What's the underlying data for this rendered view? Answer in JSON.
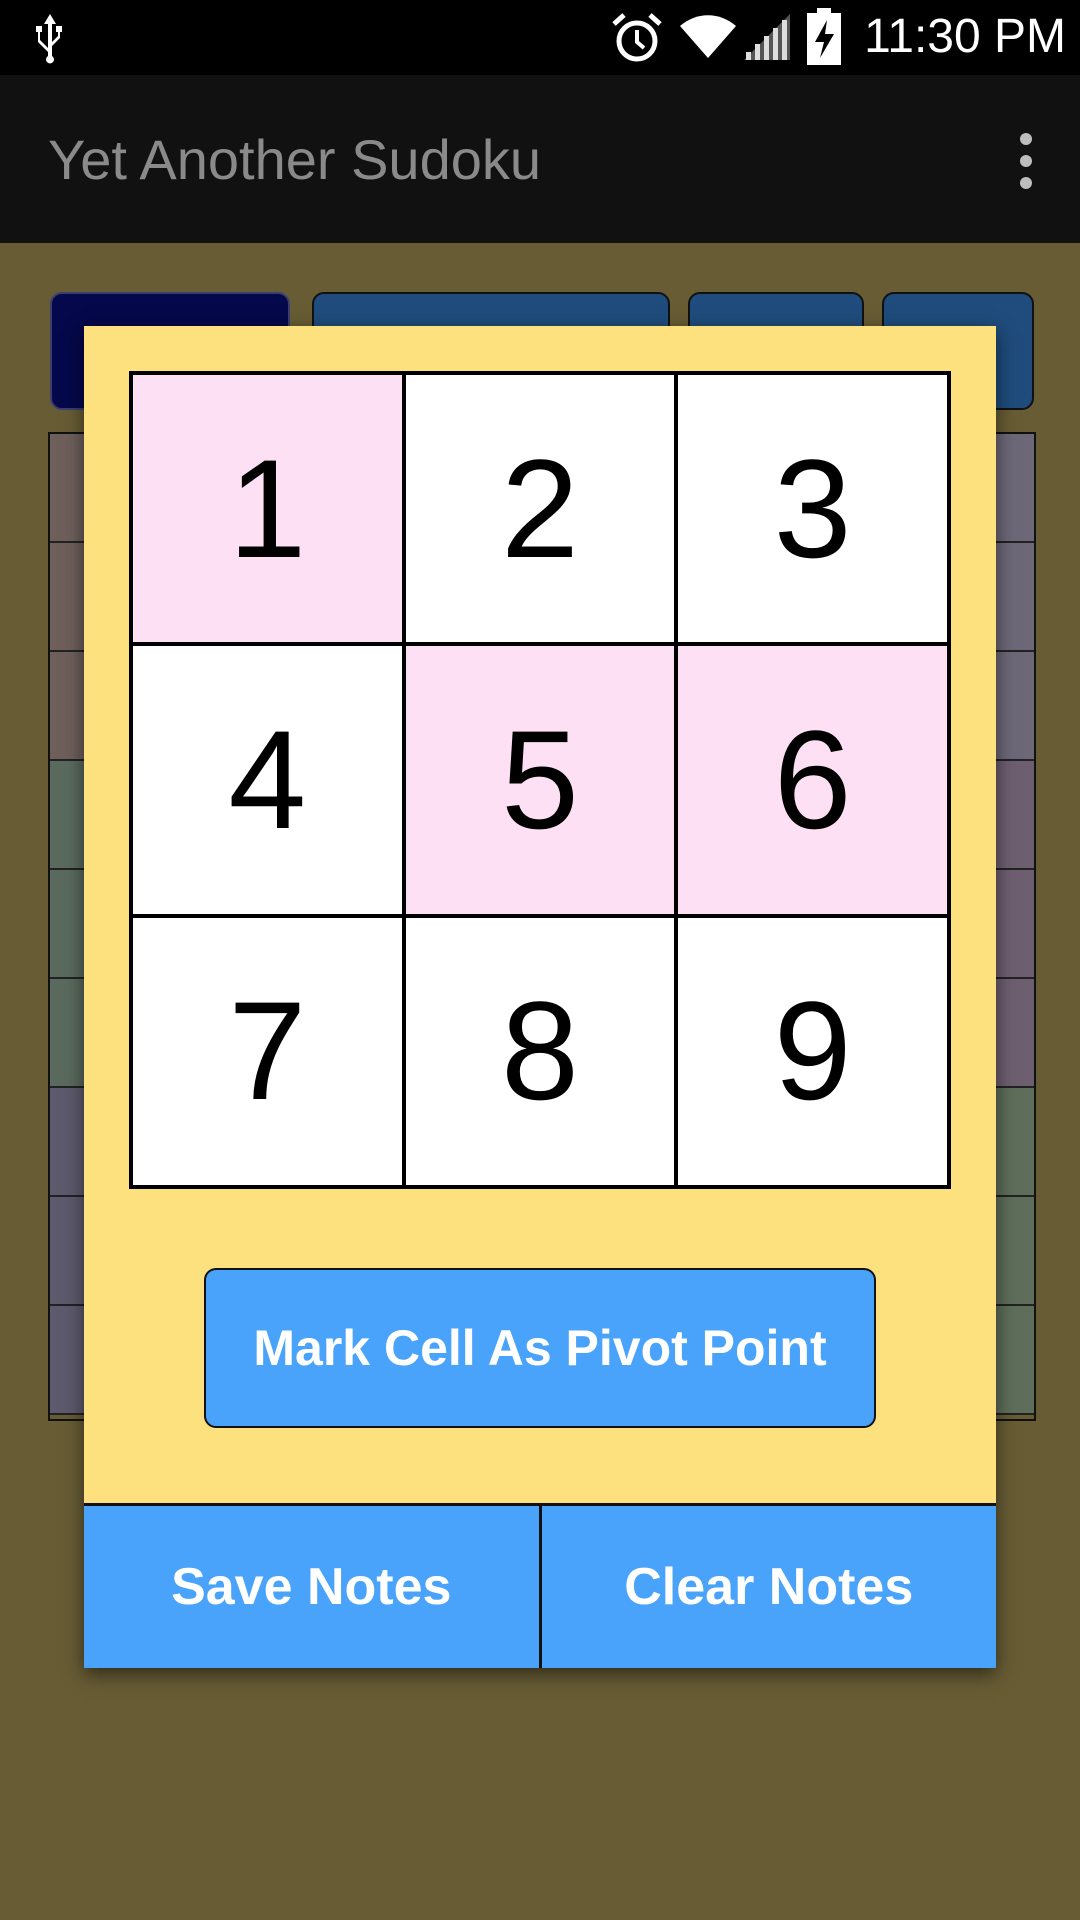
{
  "status_bar": {
    "time": "11:30 PM",
    "icons": [
      "usb-icon",
      "alarm-icon",
      "wifi-icon",
      "signal-icon",
      "battery-charging-icon"
    ]
  },
  "action_bar": {
    "title": "Yet Another Sudoku",
    "overflow_icon": "overflow-menu-icon"
  },
  "dialog": {
    "numbers": [
      {
        "label": "1",
        "selected": true
      },
      {
        "label": "2",
        "selected": false
      },
      {
        "label": "3",
        "selected": false
      },
      {
        "label": "4",
        "selected": false
      },
      {
        "label": "5",
        "selected": true
      },
      {
        "label": "6",
        "selected": true
      },
      {
        "label": "7",
        "selected": false
      },
      {
        "label": "8",
        "selected": false
      },
      {
        "label": "9",
        "selected": false
      }
    ],
    "pivot_button_label": "Mark Cell As Pivot Point",
    "save_notes_label": "Save Notes",
    "clear_notes_label": "Clear Notes"
  },
  "colors": {
    "dialog_background": "#fee17f",
    "selected_cell": "#fde0f3",
    "button_blue": "#4aa3fb",
    "app_background": "#675c34"
  },
  "background_rows": [
    {
      "left": "#6e5f5a",
      "right": "#6c6878"
    },
    {
      "left": "#6e5f5a",
      "right": "#6c6878"
    },
    {
      "left": "#6e5f5a",
      "right": "#6c6878"
    },
    {
      "left": "#5a6a5e",
      "right": "#6e5f70"
    },
    {
      "left": "#5a6a5e",
      "right": "#6e5f70"
    },
    {
      "left": "#5a6a5e",
      "right": "#6e5f70"
    },
    {
      "left": "#5e5a6e",
      "right": "#5e6e5a"
    },
    {
      "left": "#5e5a6e",
      "right": "#5e6e5a"
    },
    {
      "left": "#5e5a6e",
      "right": "#5e6e5a"
    }
  ]
}
